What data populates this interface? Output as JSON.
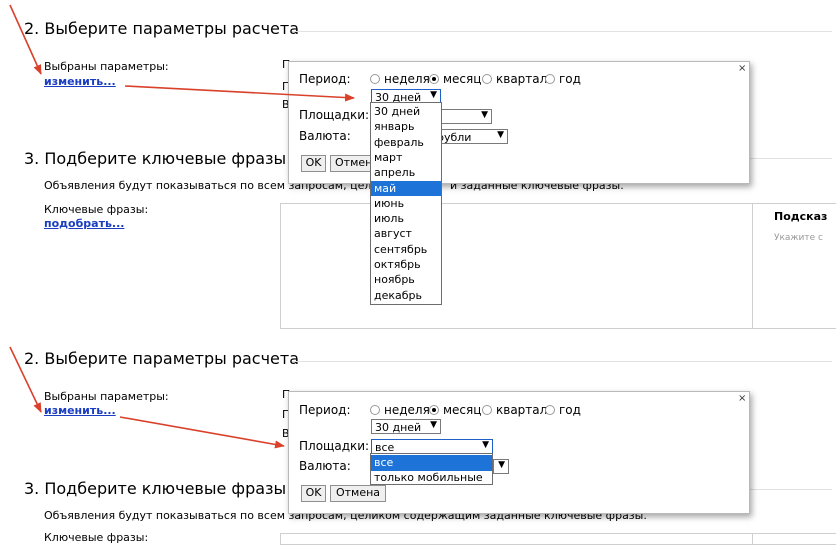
{
  "panel1": {
    "section2_title": "2. Выберите параметры расчета",
    "selected_params_label": "Выбраны параметры:",
    "change_link": "изменить...",
    "section3_title": "3. Подберите ключевые фразы",
    "ads_note": "Объявления будут показываться по всем запросам, целиком",
    "ads_note_tail": "и заданные ключевые фразы.",
    "keywords_label": "Ключевые фразы:",
    "pick_link": "подобрать...",
    "hint_title": "Подсказ",
    "hint_sub": "Укажите с",
    "clip_letters": [
      "П",
      "П",
      "В"
    ],
    "dialog": {
      "close": "×",
      "period_label": "Период:",
      "period_options": [
        "неделя",
        "месяц",
        "квартал",
        "год"
      ],
      "period_selected": "месяц",
      "days_select_value": "30 дней",
      "platforms_label": "Площадки:",
      "currency_label": "Валюта:",
      "currency_value": "рубли",
      "ok_button": "OK",
      "cancel_button": "Отмена",
      "dropdown_items": [
        "30 дней",
        "январь",
        "февраль",
        "март",
        "апрель",
        "май",
        "июнь",
        "июль",
        "август",
        "сентябрь",
        "октябрь",
        "ноябрь",
        "декабрь"
      ],
      "dropdown_selected": "май"
    }
  },
  "panel2": {
    "section2_title": "2. Выберите параметры расчета",
    "selected_params_label": "Выбраны параметры:",
    "change_link": "изменить...",
    "section3_title": "3. Подберите ключевые фразы",
    "ads_note": "Объявления будут показываться по всем запросам, целиком содержащим заданные ключевые фразы.",
    "keywords_label": "Ключевые фразы:",
    "clip_letters": [
      "П",
      "П",
      "В"
    ],
    "dialog": {
      "close": "×",
      "period_label": "Период:",
      "period_options": [
        "неделя",
        "месяц",
        "квартал",
        "год"
      ],
      "period_selected": "месяц",
      "days_select_value": "30 дней",
      "platforms_label": "Площадки:",
      "platforms_value": "все",
      "currency_label": "Валюта:",
      "ok_button": "OK",
      "cancel_button": "Отмена",
      "dropdown_items": [
        "все",
        "только мобильные"
      ],
      "dropdown_selected": "все"
    }
  },
  "colors": {
    "link": "#1a3dc1",
    "arrow": "#d9412b",
    "highlight": "#1e73d8"
  }
}
